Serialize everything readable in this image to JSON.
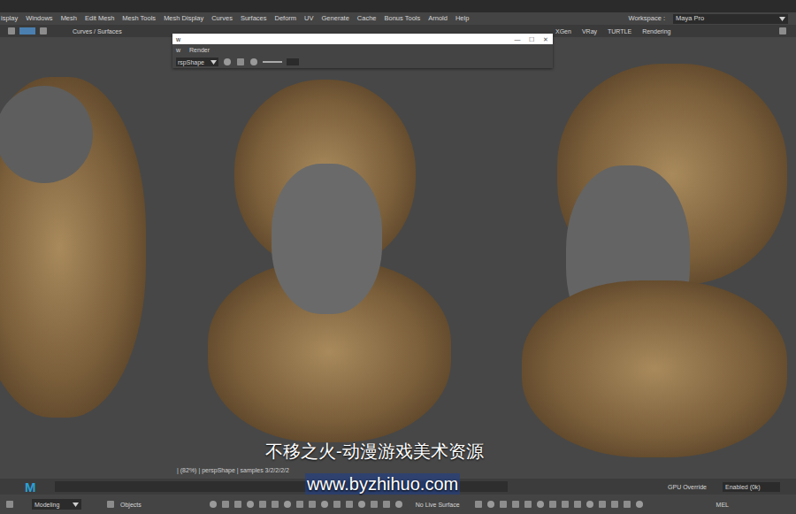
{
  "menu_bar": {
    "items": [
      "isplay",
      "Windows",
      "Mesh",
      "Edit Mesh",
      "Mesh Tools",
      "Mesh Display",
      "Curves",
      "Surfaces",
      "Deform",
      "UV",
      "Generate",
      "Cache",
      "Bonus Tools",
      "Arnold",
      "Help"
    ],
    "workspace_label": "Workspace :",
    "workspace_value": "Maya Pro"
  },
  "shelf_tabs": {
    "left": [
      "Curves / Surfaces"
    ],
    "right": [
      "XGen",
      "VRay",
      "TURTLE",
      "Rendering"
    ]
  },
  "render_view": {
    "title": "w",
    "menus": [
      "w",
      "Render"
    ],
    "camera": "rspShape",
    "controls": [
      "—",
      "☐",
      "✕"
    ]
  },
  "render_status": "| (82%) | perspShape | samples 3/2/2/2/2",
  "status_line": {
    "logo": "M",
    "gpu_override_label": "GPU Override",
    "gpu_override_value": "Enabled (0k)"
  },
  "toolbar": {
    "mode": "Modeling",
    "selection": "Objects",
    "live_surface": "No Live Surface",
    "script_lang": "MEL"
  },
  "watermark": {
    "title": "不移之火-动漫游戏美术资源",
    "url": "www.byzhihuo.com"
  }
}
